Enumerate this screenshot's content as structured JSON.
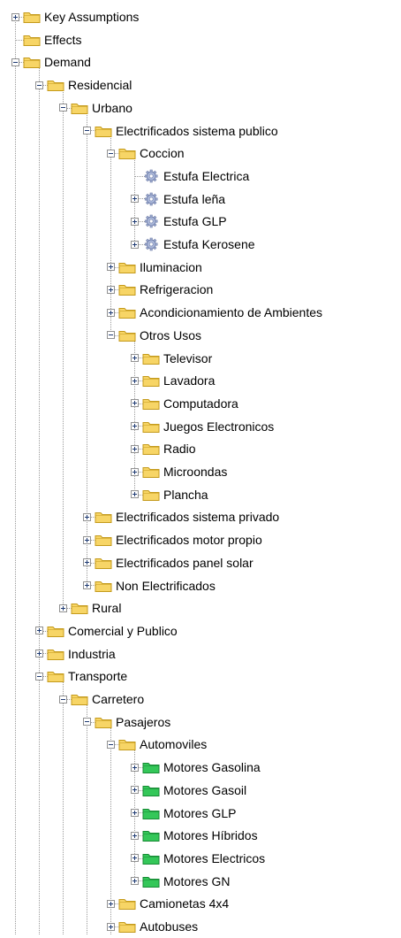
{
  "tree": [
    {
      "label": "Key Assumptions",
      "level": 0,
      "icon": "folder-icon",
      "toggle": "plus"
    },
    {
      "label": "Effects",
      "level": 0,
      "icon": "folder-icon",
      "toggle": "none"
    },
    {
      "label": "Demand",
      "level": 0,
      "icon": "folder-icon",
      "toggle": "minus"
    },
    {
      "label": "Residencial",
      "level": 1,
      "icon": "folder-icon",
      "toggle": "minus"
    },
    {
      "label": "Urbano",
      "level": 2,
      "icon": "folder-icon",
      "toggle": "minus"
    },
    {
      "label": "Electrificados sistema publico",
      "level": 3,
      "icon": "folder-icon",
      "toggle": "minus"
    },
    {
      "label": "Coccion",
      "level": 4,
      "icon": "folder-icon",
      "toggle": "minus"
    },
    {
      "label": "Estufa Electrica",
      "level": 5,
      "icon": "gear-icon",
      "toggle": "none"
    },
    {
      "label": "Estufa leña",
      "level": 5,
      "icon": "gear-icon",
      "toggle": "plus"
    },
    {
      "label": "Estufa GLP",
      "level": 5,
      "icon": "gear-icon",
      "toggle": "plus"
    },
    {
      "label": "Estufa Kerosene",
      "level": 5,
      "icon": "gear-icon",
      "toggle": "plus"
    },
    {
      "label": "Iluminacion",
      "level": 4,
      "icon": "folder-icon",
      "toggle": "plus"
    },
    {
      "label": "Refrigeracion",
      "level": 4,
      "icon": "folder-icon",
      "toggle": "plus"
    },
    {
      "label": "Acondicionamiento de Ambientes",
      "level": 4,
      "icon": "folder-icon",
      "toggle": "plus"
    },
    {
      "label": "Otros Usos",
      "level": 4,
      "icon": "folder-icon",
      "toggle": "minus"
    },
    {
      "label": "Televisor",
      "level": 5,
      "icon": "folder-icon",
      "toggle": "plus"
    },
    {
      "label": "Lavadora",
      "level": 5,
      "icon": "folder-icon",
      "toggle": "plus"
    },
    {
      "label": "Computadora",
      "level": 5,
      "icon": "folder-icon",
      "toggle": "plus"
    },
    {
      "label": "Juegos Electronicos",
      "level": 5,
      "icon": "folder-icon",
      "toggle": "plus"
    },
    {
      "label": "Radio",
      "level": 5,
      "icon": "folder-icon",
      "toggle": "plus"
    },
    {
      "label": "Microondas",
      "level": 5,
      "icon": "folder-icon",
      "toggle": "plus"
    },
    {
      "label": "Plancha",
      "level": 5,
      "icon": "folder-icon",
      "toggle": "plus"
    },
    {
      "label": "Electrificados sistema privado",
      "level": 3,
      "icon": "folder-icon",
      "toggle": "plus"
    },
    {
      "label": "Electrificados motor propio",
      "level": 3,
      "icon": "folder-icon",
      "toggle": "plus"
    },
    {
      "label": "Electrificados panel solar",
      "level": 3,
      "icon": "folder-icon",
      "toggle": "plus"
    },
    {
      "label": "Non Electrificados",
      "level": 3,
      "icon": "folder-icon",
      "toggle": "plus"
    },
    {
      "label": "Rural",
      "level": 2,
      "icon": "folder-icon",
      "toggle": "plus"
    },
    {
      "label": "Comercial y Publico",
      "level": 1,
      "icon": "folder-icon",
      "toggle": "plus"
    },
    {
      "label": "Industria",
      "level": 1,
      "icon": "folder-icon",
      "toggle": "plus"
    },
    {
      "label": "Transporte",
      "level": 1,
      "icon": "folder-icon",
      "toggle": "minus"
    },
    {
      "label": "Carretero",
      "level": 2,
      "icon": "folder-icon",
      "toggle": "minus"
    },
    {
      "label": "Pasajeros",
      "level": 3,
      "icon": "folder-icon",
      "toggle": "minus"
    },
    {
      "label": "Automoviles",
      "level": 4,
      "icon": "folder-icon",
      "toggle": "minus"
    },
    {
      "label": "Motores Gasolina",
      "level": 5,
      "icon": "green-folder-icon",
      "toggle": "plus"
    },
    {
      "label": "Motores Gasoil",
      "level": 5,
      "icon": "green-folder-icon",
      "toggle": "plus"
    },
    {
      "label": "Motores GLP",
      "level": 5,
      "icon": "green-folder-icon",
      "toggle": "plus"
    },
    {
      "label": "Motores Híbridos",
      "level": 5,
      "icon": "green-folder-icon",
      "toggle": "plus"
    },
    {
      "label": "Motores Electricos",
      "level": 5,
      "icon": "green-folder-icon",
      "toggle": "plus"
    },
    {
      "label": "Motores GN",
      "level": 5,
      "icon": "green-folder-icon",
      "toggle": "plus"
    },
    {
      "label": "Camionetas 4x4",
      "level": 4,
      "icon": "folder-icon",
      "toggle": "plus"
    },
    {
      "label": "Autobuses",
      "level": 4,
      "icon": "folder-icon",
      "toggle": "plus"
    }
  ],
  "colors": {
    "folder_fill": "#f7d566",
    "folder_stroke": "#c49a1b",
    "green_folder_fill": "#34c759",
    "green_folder_stroke": "#178a34",
    "gear_fill": "#a9b6d8",
    "gear_stroke": "#6b7aa6"
  }
}
